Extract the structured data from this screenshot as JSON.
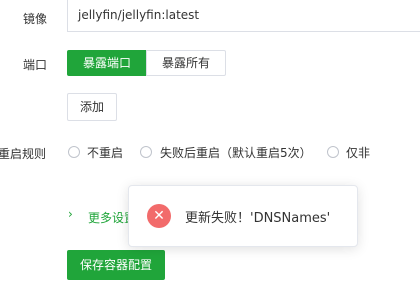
{
  "form": {
    "image_label": "镜像",
    "image_value": "jellyfin/jellyfin:latest",
    "port_label": "端口",
    "port_tabs": [
      "暴露端口",
      "暴露所有"
    ],
    "add_button": "添加",
    "restart_label": "重启规则",
    "restart_options": [
      "不重启",
      "失败后重启（默认重启5次）",
      "仅非"
    ],
    "more_settings": "更多设置",
    "save_button": "保存容器配置"
  },
  "toast": {
    "message": "更新失败！'DNSNames'",
    "icon": "error-icon"
  },
  "colors": {
    "accent": "#20a53a",
    "error": "#f26b6b"
  }
}
